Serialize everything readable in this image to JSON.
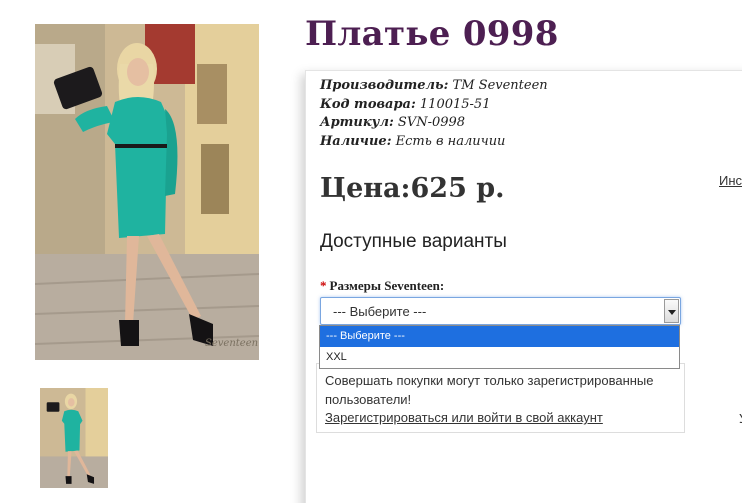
{
  "product": {
    "title": "Платье 0998",
    "image_alt": "dress-photo"
  },
  "meta": [
    {
      "label": "Производитель:",
      "value": " ТМ Seventeen"
    },
    {
      "label": "Код товара:",
      "value": " 110015-51"
    },
    {
      "label": "Артикул:",
      "value": " SVN-0998"
    },
    {
      "label": "Наличие:",
      "value": " Есть в наличии"
    }
  ],
  "price": {
    "text": "Цена:625 р."
  },
  "side_link": "Инс",
  "options": {
    "heading": "Доступные варианты",
    "required_mark": "*",
    "size_label": "Размеры Seventeen:",
    "select_value": "--- Выберите ---",
    "dropdown_items": [
      {
        "label": "--- Выберите ---",
        "selected": true
      },
      {
        "label": "XXL",
        "selected": false
      }
    ]
  },
  "notice": {
    "text": "Совершать покупки могут только зарегистрированные пользователи!",
    "link": "Зарегистрироваться или войти в свой аккаунт"
  },
  "edge_mark": "У",
  "colors": {
    "title": "#4d1f52",
    "dress": "#1fb3a0",
    "selected_option": "#1e6fe0"
  }
}
